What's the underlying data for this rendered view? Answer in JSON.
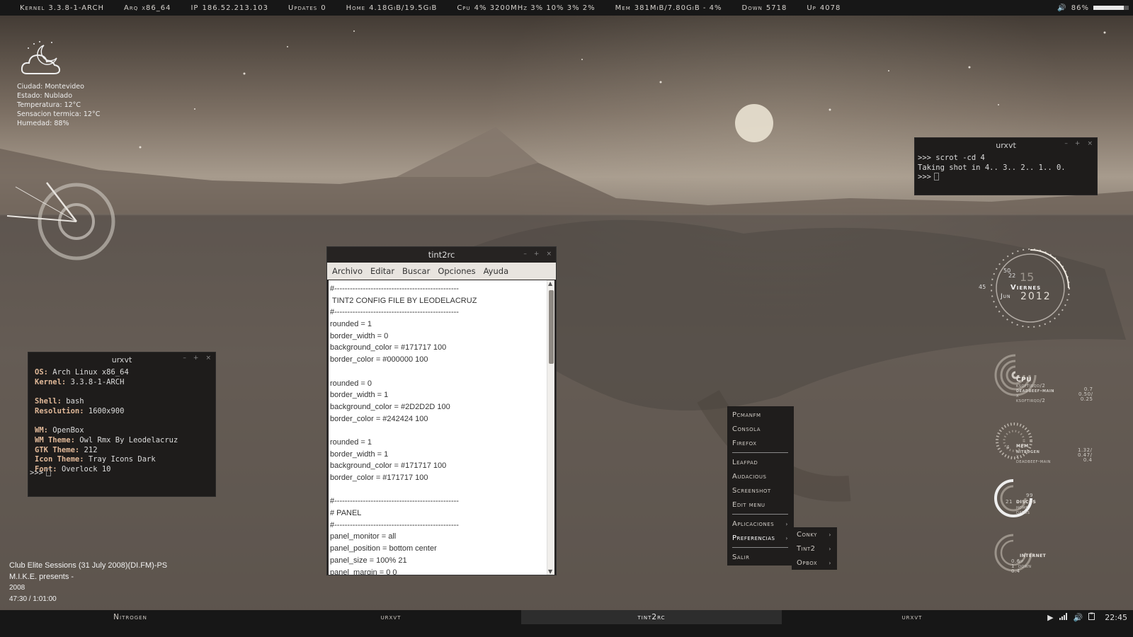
{
  "topbar": {
    "kernel_label": "Kernel",
    "kernel_value": "3.3.8-1-ARCH",
    "arq_label": "Arq",
    "arq_value": "x86_64",
    "ip_label": "IP",
    "ip_value": "186.52.213.103",
    "updates_label": "Updates",
    "updates_value": "0",
    "home_label": "Home",
    "home_value": "4.18GiB/19.5GiB",
    "cpu_label": "Cpu",
    "cpu_value": "4%  3200MHz 3% 10% 3% 2%",
    "mem_label": "Mem",
    "mem_value": "381MiB/7.80GiB - 4%",
    "down_label": "Down",
    "down_value": "5718",
    "up_label": "Up",
    "up_value": "4078",
    "volume_text": "86%",
    "volume_level": 0.86
  },
  "weather": {
    "icon": "cloud-night-icon",
    "ciudad": "Ciudad: Montevideo",
    "estado": "Estado: Nublado",
    "temperatura": "Temperatura: 12°C",
    "sensacion": "Sensacion termica: 12°C",
    "humedad": "Humedad: 88%"
  },
  "term_sysinfo": {
    "title": "urxvt",
    "os_label": "OS:",
    "os_value": "Arch Linux x86_64",
    "kernel_label": "Kernel:",
    "kernel_value": "3.3.8-1-ARCH",
    "shell_label": "Shell:",
    "shell_value": "bash",
    "resolution_label": "Resolution:",
    "resolution_value": "1600x900",
    "wm_label": "WM:",
    "wm_value": "OpenBox",
    "wmtheme_label": "WM Theme:",
    "wmtheme_value": "Owl Rmx By Leodelacruz",
    "gtk_label": "GTK Theme:",
    "gtk_value": "212",
    "icon_label": "Icon Theme:",
    "icon_value": "Tray Icons Dark",
    "font_label": "Font:",
    "font_value": "Overlock 10",
    "prompt": ">>>"
  },
  "term_scrot": {
    "title": "urxvt",
    "line1": ">>> scrot -cd 4",
    "line2": "Taking shot in 4.. 3.. 2.. 1.. 0.",
    "line3": ">>>"
  },
  "editor": {
    "title": "tint2rc",
    "menu": [
      "Archivo",
      "Editar",
      "Buscar",
      "Opciones",
      "Ayuda"
    ],
    "lines": [
      "#------------------------------------------------",
      " TINT2 CONFIG FILE BY LEODELACRUZ",
      "#------------------------------------------------",
      "rounded = 1",
      "border_width = 0",
      "background_color = #171717 100",
      "border_color = #000000 100",
      "",
      "rounded = 0",
      "border_width = 1",
      "background_color = #2D2D2D 100",
      "border_color = #242424 100",
      "",
      "rounded = 1",
      "border_width = 1",
      "background_color = #171717 100",
      "border_color = #171717 100",
      "",
      "#------------------------------------------------",
      "# PANEL",
      "#------------------------------------------------",
      "panel_monitor = all",
      "panel_position = bottom center",
      "panel_size = 100% 21",
      "panel_margin = 0 0"
    ]
  },
  "obmenu": {
    "items": [
      "Pcmanfm",
      "Consola",
      "Firefox",
      "Leafpad",
      "Audacious",
      "Screenshot",
      "Edit menu",
      "Aplicaciones",
      "Preferencias",
      "Salir"
    ],
    "submenu": [
      "Conky",
      "Tint2",
      "Opbox"
    ]
  },
  "clock_right": {
    "min_label": "50",
    "hour_label": "22",
    "sec_label": "45",
    "day_number": "15",
    "weekday": "Viernes",
    "month": "Jun",
    "year": "2012"
  },
  "conky_rings": {
    "cpu": {
      "title": "CPU",
      "procs": [
        "ksoftirqd/2",
        "deadbeef-main",
        "x",
        "ksoftirqd/2"
      ],
      "vals": [
        "0.7",
        "0.50/",
        "0.25"
      ]
    },
    "mem": {
      "title": "mem",
      "procs": [
        "nitrogen",
        "x",
        "deadbeef-main"
      ],
      "vals": [
        "1.32/",
        "0.47/",
        "0.4"
      ],
      "left": "4"
    },
    "discos": {
      "title": "discos",
      "sub": [
        "home",
        "datos"
      ],
      "left": "21",
      "right": "99"
    },
    "internet": {
      "title": "internet",
      "sub": [
        "up",
        "down"
      ],
      "vals": [
        "0.6",
        "1",
        "0.4"
      ]
    }
  },
  "nowplaying": {
    "line1": "Club Elite Sessions (31 July 2008)(DI.FM)-PS",
    "line2": "M.I.K.E. presents -",
    "line3": "2008",
    "line4": "47:30 / 1:01:00"
  },
  "taskbar": {
    "tasks": [
      "Nitrogen",
      "urxvt",
      "tint2rc",
      "urxvt"
    ],
    "clock": "22:45"
  }
}
